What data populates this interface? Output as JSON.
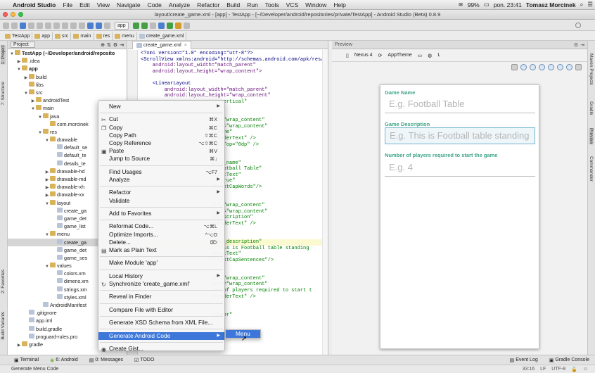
{
  "menubar": {
    "app": "Android Studio",
    "items": [
      "File",
      "Edit",
      "View",
      "Navigate",
      "Code",
      "Analyze",
      "Refactor",
      "Build",
      "Run",
      "Tools",
      "VCS",
      "Window",
      "Help"
    ],
    "battery": "99%",
    "clock": "pon. 23:41",
    "user": "Tomasz Morcinek"
  },
  "window": {
    "title": "layout/create_game.xml - [app] - TestApp - [~/Developer/android/repositories/private/TestApp] - Android Studio (Beta) 0.8.9"
  },
  "toolbar": {
    "run_config": "app"
  },
  "navbar": {
    "crumbs": [
      "TestApp",
      "app",
      "src",
      "main",
      "res",
      "menu",
      "create_game.xml"
    ]
  },
  "project": {
    "header": "Project",
    "tree": [
      {
        "label": "TestApp (~/Developer/android/reposito",
        "level": 0,
        "arrow": "▼",
        "kind": "module",
        "bold": true
      },
      {
        "label": ".idea",
        "level": 1,
        "arrow": "▶",
        "kind": "folder"
      },
      {
        "label": "app",
        "level": 1,
        "arrow": "▼",
        "kind": "folder",
        "bold": true
      },
      {
        "label": "build",
        "level": 2,
        "arrow": "▶",
        "kind": "folder"
      },
      {
        "label": "libs",
        "level": 2,
        "arrow": "",
        "kind": "folder"
      },
      {
        "label": "src",
        "level": 2,
        "arrow": "▼",
        "kind": "folder"
      },
      {
        "label": "androidTest",
        "level": 3,
        "arrow": "▶",
        "kind": "folder"
      },
      {
        "label": "main",
        "level": 3,
        "arrow": "▼",
        "kind": "folder"
      },
      {
        "label": "java",
        "level": 4,
        "arrow": "▼",
        "kind": "folder"
      },
      {
        "label": "com.morcinek",
        "level": 5,
        "arrow": "",
        "kind": "folder"
      },
      {
        "label": "res",
        "level": 4,
        "arrow": "▼",
        "kind": "folder"
      },
      {
        "label": "drawable",
        "level": 5,
        "arrow": "▼",
        "kind": "folder"
      },
      {
        "label": "default_se",
        "level": 6,
        "arrow": "",
        "kind": "file"
      },
      {
        "label": "default_te",
        "level": 6,
        "arrow": "",
        "kind": "file"
      },
      {
        "label": "details_te",
        "level": 6,
        "arrow": "",
        "kind": "file"
      },
      {
        "label": "drawable-hd",
        "level": 5,
        "arrow": "▶",
        "kind": "folder"
      },
      {
        "label": "drawable-md",
        "level": 5,
        "arrow": "▶",
        "kind": "folder"
      },
      {
        "label": "drawable-xh",
        "level": 5,
        "arrow": "▶",
        "kind": "folder"
      },
      {
        "label": "drawable-xx",
        "level": 5,
        "arrow": "▶",
        "kind": "folder"
      },
      {
        "label": "layout",
        "level": 5,
        "arrow": "▼",
        "kind": "folder"
      },
      {
        "label": "create_ga",
        "level": 6,
        "arrow": "",
        "kind": "file"
      },
      {
        "label": "game_det",
        "level": 6,
        "arrow": "",
        "kind": "file"
      },
      {
        "label": "game_list",
        "level": 6,
        "arrow": "",
        "kind": "file"
      },
      {
        "label": "menu",
        "level": 5,
        "arrow": "▼",
        "kind": "folder"
      },
      {
        "label": "create_ga",
        "level": 6,
        "arrow": "",
        "kind": "file",
        "selected": true
      },
      {
        "label": "game_det",
        "level": 6,
        "arrow": "",
        "kind": "file"
      },
      {
        "label": "game_ses",
        "level": 6,
        "arrow": "",
        "kind": "file"
      },
      {
        "label": "values",
        "level": 5,
        "arrow": "▼",
        "kind": "folder"
      },
      {
        "label": "colors.xm",
        "level": 6,
        "arrow": "",
        "kind": "file"
      },
      {
        "label": "dimens.xm",
        "level": 6,
        "arrow": "",
        "kind": "file"
      },
      {
        "label": "strings.xm",
        "level": 6,
        "arrow": "",
        "kind": "file"
      },
      {
        "label": "styles.xml",
        "level": 6,
        "arrow": "",
        "kind": "file"
      },
      {
        "label": "AndroidManifest",
        "level": 4,
        "arrow": "",
        "kind": "file"
      },
      {
        "label": ".gitignore",
        "level": 2,
        "arrow": "",
        "kind": "file"
      },
      {
        "label": "app.iml",
        "level": 2,
        "arrow": "",
        "kind": "file"
      },
      {
        "label": "build.gradle",
        "level": 2,
        "arrow": "",
        "kind": "file"
      },
      {
        "label": "proguard-rules.pro",
        "level": 2,
        "arrow": "",
        "kind": "file"
      },
      {
        "label": "gradle",
        "level": 1,
        "arrow": "▶",
        "kind": "folder"
      }
    ]
  },
  "editor": {
    "tab": "create_game.xml",
    "lines": [
      {
        "t": "<?xml version=\"1.0\" encoding=\"utf-8\"?>",
        "c": "#000080"
      },
      {
        "t": "<ScrollView xmlns:android=\"http://schemas.android.com/apk/res/a",
        "c": "#000080"
      },
      {
        "t": "    android:layout_width=\"match_parent\"",
        "c": "#660e7a"
      },
      {
        "t": "    android:layout_height=\"wrap_content\">",
        "c": "#660e7a"
      },
      {
        "t": "",
        "c": "#000"
      },
      {
        "t": "    <LinearLayout",
        "c": "#000080"
      },
      {
        "t": "        android:layout_width=\"match_parent\"",
        "c": "#660e7a"
      },
      {
        "t": "        android:layout_height=\"wrap_content\"",
        "c": "#660e7a"
      },
      {
        "t": "                           vertical\"",
        "c": "#008000"
      },
      {
        "t": "",
        "c": "#000"
      },
      {
        "t": "",
        "c": "#000"
      },
      {
        "t": "                        dth=\"wrap_content\"",
        "c": "#008000"
      },
      {
        "t": "                        ight=\"wrap_content\"",
        "c": "#008000"
      },
      {
        "t": "                        e Name\"",
        "c": "#008000"
      },
      {
        "t": "                        mHeaderText\" />",
        "c": "#008000"
      },
      {
        "t": "                        rginTop=\"0dp\" />",
        "c": "#008000"
      },
      {
        "t": "",
        "c": "#000"
      },
      {
        "t": "",
        "c": "#000"
      },
      {
        "t": "                        game_name\"",
        "c": "#008000"
      },
      {
        "t": "                        . Football Table\"",
        "c": "#008000"
      },
      {
        "t": "                        mEditText\"",
        "c": "#008000"
      },
      {
        "t": "                        e=\"true\"",
        "c": "#008000"
      },
      {
        "t": "                        =\"textCapWords\"/>",
        "c": "#008000"
      },
      {
        "t": "",
        "c": "#000"
      },
      {
        "t": "",
        "c": "#000"
      },
      {
        "t": "                        dth=\"wrap_content\"",
        "c": "#008000"
      },
      {
        "t": "                        ight=\"wrap_content\"",
        "c": "#008000"
      },
      {
        "t": "                        e Description\"",
        "c": "#008000"
      },
      {
        "t": "                        mHeaderText\" />",
        "c": "#008000"
      },
      {
        "t": "",
        "c": "#000"
      },
      {
        "t": "",
        "c": "#000"
      },
      {
        "t": "                        game_description\"",
        "c": "#008000",
        "hl": true
      },
      {
        "t": "                        . This is Football table standing",
        "c": "#008000"
      },
      {
        "t": "                        mEditText\"",
        "c": "#008000"
      },
      {
        "t": "                        =\"textCapSentences\"/>",
        "c": "#008000"
      },
      {
        "t": "",
        "c": "#000"
      },
      {
        "t": "",
        "c": "#000"
      },
      {
        "t": "                        dth=\"wrap_content\"",
        "c": "#008000"
      },
      {
        "t": "                        ight=\"wrap_content\"",
        "c": "#008000"
      },
      {
        "t": "                        ber of players required to start t",
        "c": "#008000"
      },
      {
        "t": "                        mHeaderText\" />",
        "c": "#008000"
      },
      {
        "t": "",
        "c": "#000"
      },
      {
        "t": "",
        "c": "#000"
      },
      {
        "t": "                        number\"",
        "c": "#008000"
      }
    ]
  },
  "preview": {
    "header": "Preview",
    "device": "Nexus 4",
    "theme": "AppTheme",
    "fields": [
      {
        "label": "Game Name",
        "hint": "E.g. Football Table"
      },
      {
        "label": "Game Description",
        "hint": "E.g. This is Football table standing"
      },
      {
        "label": "Number of players required to start the game",
        "hint": "E.g. 4"
      }
    ]
  },
  "context_menu": [
    {
      "label": "New",
      "arrow": true
    },
    {
      "sep": true
    },
    {
      "label": "Cut",
      "shortcut": "⌘X",
      "icon": "✂"
    },
    {
      "label": "Copy",
      "shortcut": "⌘C",
      "icon": "❐"
    },
    {
      "label": "Copy Path",
      "shortcut": "⇧⌘C"
    },
    {
      "label": "Copy Reference",
      "shortcut": "⌥⇧⌘C"
    },
    {
      "label": "Paste",
      "shortcut": "⌘V",
      "icon": "▣"
    },
    {
      "label": "Jump to Source",
      "shortcut": "⌘↓"
    },
    {
      "sep": true
    },
    {
      "label": "Find Usages",
      "shortcut": "⌥F7"
    },
    {
      "label": "Analyze",
      "arrow": true
    },
    {
      "sep": true
    },
    {
      "label": "Refactor",
      "arrow": true
    },
    {
      "label": "Validate"
    },
    {
      "sep": true
    },
    {
      "label": "Add to Favorites",
      "arrow": true
    },
    {
      "sep": true
    },
    {
      "label": "Reformat Code...",
      "shortcut": "⌥⌘L"
    },
    {
      "label": "Optimize Imports...",
      "shortcut": "^⌥O"
    },
    {
      "label": "Delete...",
      "shortcut": "⌦"
    },
    {
      "label": "Mark as Plain Text",
      "icon": "▤"
    },
    {
      "sep": true
    },
    {
      "label": "Make Module 'app'"
    },
    {
      "sep": true
    },
    {
      "label": "Local History",
      "arrow": true
    },
    {
      "label": "Synchronize 'create_game.xml'",
      "icon": "↻"
    },
    {
      "sep": true
    },
    {
      "label": "Reveal in Finder"
    },
    {
      "sep": true
    },
    {
      "label": "Compare File with Editor"
    },
    {
      "sep": true
    },
    {
      "label": "Generate XSD Schema from XML File..."
    },
    {
      "sep": true
    },
    {
      "label": "Generate Android Code",
      "arrow": true,
      "hot": true
    },
    {
      "sep": true
    },
    {
      "label": "Create Gist...",
      "icon": "◉"
    }
  ],
  "submenu": {
    "item": "Menu"
  },
  "bottom": {
    "left_tabs": [
      "Terminal",
      "6: Android",
      "0: Messages",
      "TODO"
    ],
    "right_tabs": [
      "Event Log",
      "Gradle Console"
    ]
  },
  "status": {
    "message": "Generate Menu Code",
    "position": "33:16",
    "line_sep": "LF",
    "encoding": "UTF-8"
  },
  "stripes": {
    "left": [
      "1: Project",
      "7: Structure",
      "2: Favorites",
      "Build Variants"
    ],
    "right": [
      "Maven Projects",
      "Gradle",
      "Preview",
      "Commander"
    ]
  },
  "colors": {
    "accent": "#3d77d9",
    "label_green": "#3fa589",
    "hint_gray": "#b5b5b5"
  }
}
